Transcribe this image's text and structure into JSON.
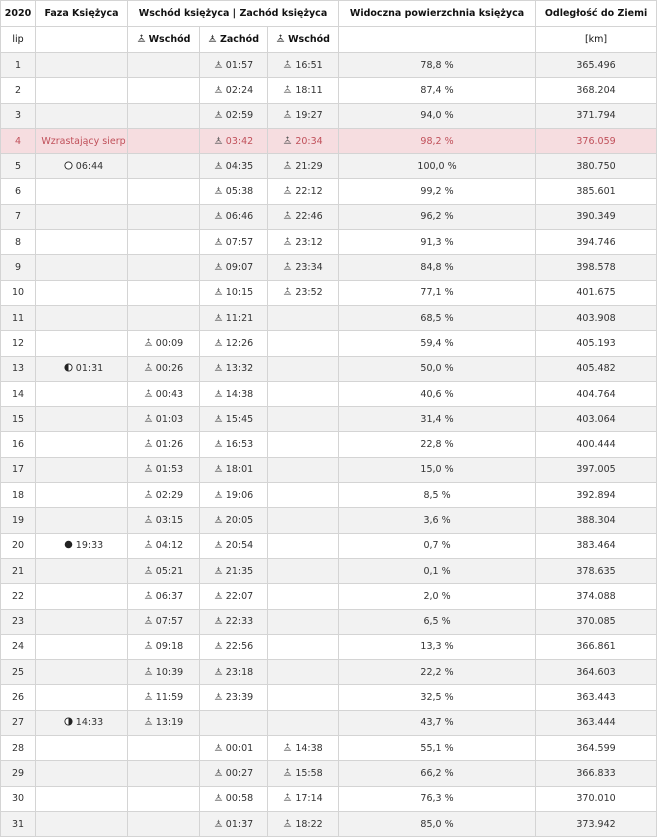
{
  "header": {
    "year": "2020",
    "phase": "Faza Księżyca",
    "riseset": "Wschód księżyca | Zachód księżyca",
    "visible": "Widoczna powierzchnia księżyca",
    "distance": "Odległość do Ziemi",
    "month": "lip",
    "rise1": "Wschód",
    "set": "Zachód",
    "rise2": "Wschód",
    "unit": "[km]"
  },
  "current_day": "4",
  "rows": [
    {
      "day": "1",
      "phase": "",
      "phase_icon": "",
      "rise1": "",
      "set": "01:57",
      "rise2": "16:51",
      "vis": "78,8 %",
      "dist": "365.496"
    },
    {
      "day": "2",
      "phase": "",
      "phase_icon": "",
      "rise1": "",
      "set": "02:24",
      "rise2": "18:11",
      "vis": "87,4 %",
      "dist": "368.204"
    },
    {
      "day": "3",
      "phase": "",
      "phase_icon": "",
      "rise1": "",
      "set": "02:59",
      "rise2": "19:27",
      "vis": "94,0 %",
      "dist": "371.794"
    },
    {
      "day": "4",
      "phase": "Wzrastający sierp",
      "phase_icon": "",
      "rise1": "",
      "set": "03:42",
      "rise2": "20:34",
      "vis": "98,2 %",
      "dist": "376.059"
    },
    {
      "day": "5",
      "phase": "06:44",
      "phase_icon": "full-moon-icon",
      "rise1": "",
      "set": "04:35",
      "rise2": "21:29",
      "vis": "100,0 %",
      "dist": "380.750"
    },
    {
      "day": "6",
      "phase": "",
      "phase_icon": "",
      "rise1": "",
      "set": "05:38",
      "rise2": "22:12",
      "vis": "99,2 %",
      "dist": "385.601"
    },
    {
      "day": "7",
      "phase": "",
      "phase_icon": "",
      "rise1": "",
      "set": "06:46",
      "rise2": "22:46",
      "vis": "96,2 %",
      "dist": "390.349"
    },
    {
      "day": "8",
      "phase": "",
      "phase_icon": "",
      "rise1": "",
      "set": "07:57",
      "rise2": "23:12",
      "vis": "91,3 %",
      "dist": "394.746"
    },
    {
      "day": "9",
      "phase": "",
      "phase_icon": "",
      "rise1": "",
      "set": "09:07",
      "rise2": "23:34",
      "vis": "84,8 %",
      "dist": "398.578"
    },
    {
      "day": "10",
      "phase": "",
      "phase_icon": "",
      "rise1": "",
      "set": "10:15",
      "rise2": "23:52",
      "vis": "77,1 %",
      "dist": "401.675"
    },
    {
      "day": "11",
      "phase": "",
      "phase_icon": "",
      "rise1": "",
      "set": "11:21",
      "rise2": "",
      "vis": "68,5 %",
      "dist": "403.908"
    },
    {
      "day": "12",
      "phase": "",
      "phase_icon": "",
      "rise1": "00:09",
      "set": "12:26",
      "rise2": "",
      "vis": "59,4 %",
      "dist": "405.193"
    },
    {
      "day": "13",
      "phase": "01:31",
      "phase_icon": "last-quarter-icon",
      "rise1": "00:26",
      "set": "13:32",
      "rise2": "",
      "vis": "50,0 %",
      "dist": "405.482"
    },
    {
      "day": "14",
      "phase": "",
      "phase_icon": "",
      "rise1": "00:43",
      "set": "14:38",
      "rise2": "",
      "vis": "40,6 %",
      "dist": "404.764"
    },
    {
      "day": "15",
      "phase": "",
      "phase_icon": "",
      "rise1": "01:03",
      "set": "15:45",
      "rise2": "",
      "vis": "31,4 %",
      "dist": "403.064"
    },
    {
      "day": "16",
      "phase": "",
      "phase_icon": "",
      "rise1": "01:26",
      "set": "16:53",
      "rise2": "",
      "vis": "22,8 %",
      "dist": "400.444"
    },
    {
      "day": "17",
      "phase": "",
      "phase_icon": "",
      "rise1": "01:53",
      "set": "18:01",
      "rise2": "",
      "vis": "15,0 %",
      "dist": "397.005"
    },
    {
      "day": "18",
      "phase": "",
      "phase_icon": "",
      "rise1": "02:29",
      "set": "19:06",
      "rise2": "",
      "vis": "8,5 %",
      "dist": "392.894"
    },
    {
      "day": "19",
      "phase": "",
      "phase_icon": "",
      "rise1": "03:15",
      "set": "20:05",
      "rise2": "",
      "vis": "3,6 %",
      "dist": "388.304"
    },
    {
      "day": "20",
      "phase": "19:33",
      "phase_icon": "new-moon-icon",
      "rise1": "04:12",
      "set": "20:54",
      "rise2": "",
      "vis": "0,7 %",
      "dist": "383.464"
    },
    {
      "day": "21",
      "phase": "",
      "phase_icon": "",
      "rise1": "05:21",
      "set": "21:35",
      "rise2": "",
      "vis": "0,1 %",
      "dist": "378.635"
    },
    {
      "day": "22",
      "phase": "",
      "phase_icon": "",
      "rise1": "06:37",
      "set": "22:07",
      "rise2": "",
      "vis": "2,0 %",
      "dist": "374.088"
    },
    {
      "day": "23",
      "phase": "",
      "phase_icon": "",
      "rise1": "07:57",
      "set": "22:33",
      "rise2": "",
      "vis": "6,5 %",
      "dist": "370.085"
    },
    {
      "day": "24",
      "phase": "",
      "phase_icon": "",
      "rise1": "09:18",
      "set": "22:56",
      "rise2": "",
      "vis": "13,3 %",
      "dist": "366.861"
    },
    {
      "day": "25",
      "phase": "",
      "phase_icon": "",
      "rise1": "10:39",
      "set": "23:18",
      "rise2": "",
      "vis": "22,2 %",
      "dist": "364.603"
    },
    {
      "day": "26",
      "phase": "",
      "phase_icon": "",
      "rise1": "11:59",
      "set": "23:39",
      "rise2": "",
      "vis": "32,5 %",
      "dist": "363.443"
    },
    {
      "day": "27",
      "phase": "14:33",
      "phase_icon": "first-quarter-icon",
      "rise1": "13:19",
      "set": "",
      "rise2": "",
      "vis": "43,7 %",
      "dist": "363.444"
    },
    {
      "day": "28",
      "phase": "",
      "phase_icon": "",
      "rise1": "",
      "set": "00:01",
      "rise2": "14:38",
      "vis": "55,1 %",
      "dist": "364.599"
    },
    {
      "day": "29",
      "phase": "",
      "phase_icon": "",
      "rise1": "",
      "set": "00:27",
      "rise2": "15:58",
      "vis": "66,2 %",
      "dist": "366.833"
    },
    {
      "day": "30",
      "phase": "",
      "phase_icon": "",
      "rise1": "",
      "set": "00:58",
      "rise2": "17:14",
      "vis": "76,3 %",
      "dist": "370.010"
    },
    {
      "day": "31",
      "phase": "",
      "phase_icon": "",
      "rise1": "",
      "set": "01:37",
      "rise2": "18:22",
      "vis": "85,0 %",
      "dist": "373.942"
    }
  ]
}
